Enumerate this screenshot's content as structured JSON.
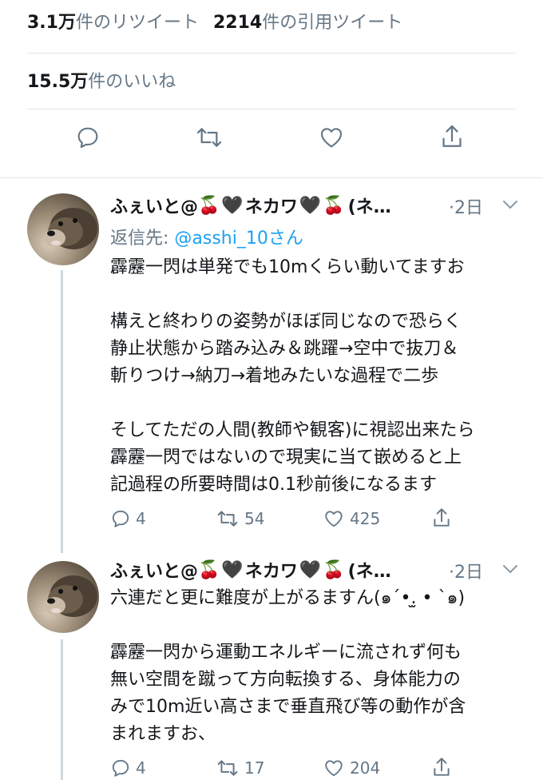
{
  "stats": {
    "retweets_value": "3.1万",
    "retweets_label": "件のリツイート",
    "quotes_value": "2214",
    "quotes_label": "件の引用ツイート",
    "likes_value": "15.5万",
    "likes_label": "件のいいね"
  },
  "main_actions": {
    "reply_icon": "reply-icon",
    "retweet_icon": "retweet-icon",
    "like_icon": "heart-icon",
    "share_icon": "share-icon"
  },
  "replies": [
    {
      "display_name": "ふぇいと@",
      "emoji_cherry": "🍒",
      "emoji_heart": "🖤",
      "name_mid": "ネカワ",
      "name_tail": "(ネ…",
      "time": "·2日",
      "reply_to_prefix": "返信先: ",
      "reply_to_handle": "@asshi_10さん",
      "text": "霹靂一閃は単発でも10mくらい動いてますお\n\n構えと終わりの姿勢がほぼ同じなので恐らく\n静止状態から踏み込み＆跳躍→空中で抜刀＆\n斬りつけ→納刀→着地みたいな過程で二歩\n\nそしてただの人間(教師や観客)に視認出来たら\n霹靂一閃ではないので現実に当て嵌めると上\n記過程の所要時間は0.1秒前後になるます",
      "reply_count": "4",
      "retweet_count": "54",
      "like_count": "425"
    },
    {
      "display_name": "ふぇいと@",
      "emoji_cherry": "🍒",
      "emoji_heart": "🖤",
      "name_mid": "ネカワ",
      "name_tail": "(ネ…",
      "time": "·2日",
      "text": "六連だと更に難度が上がるますん(๑´•.̫ • `๑)\n\n霹靂一閃から運動エネルギーに流されず何も\n無い空間を蹴って方向転換する、身体能力の\nみで10m近い高さまで垂直飛び等の動作が含\nまれますお、",
      "reply_count": "4",
      "retweet_count": "17",
      "like_count": "204"
    }
  ],
  "colors": {
    "text": "#14171a",
    "secondary": "#657786",
    "link": "#1da1f2",
    "divider": "#e1e8ed"
  }
}
